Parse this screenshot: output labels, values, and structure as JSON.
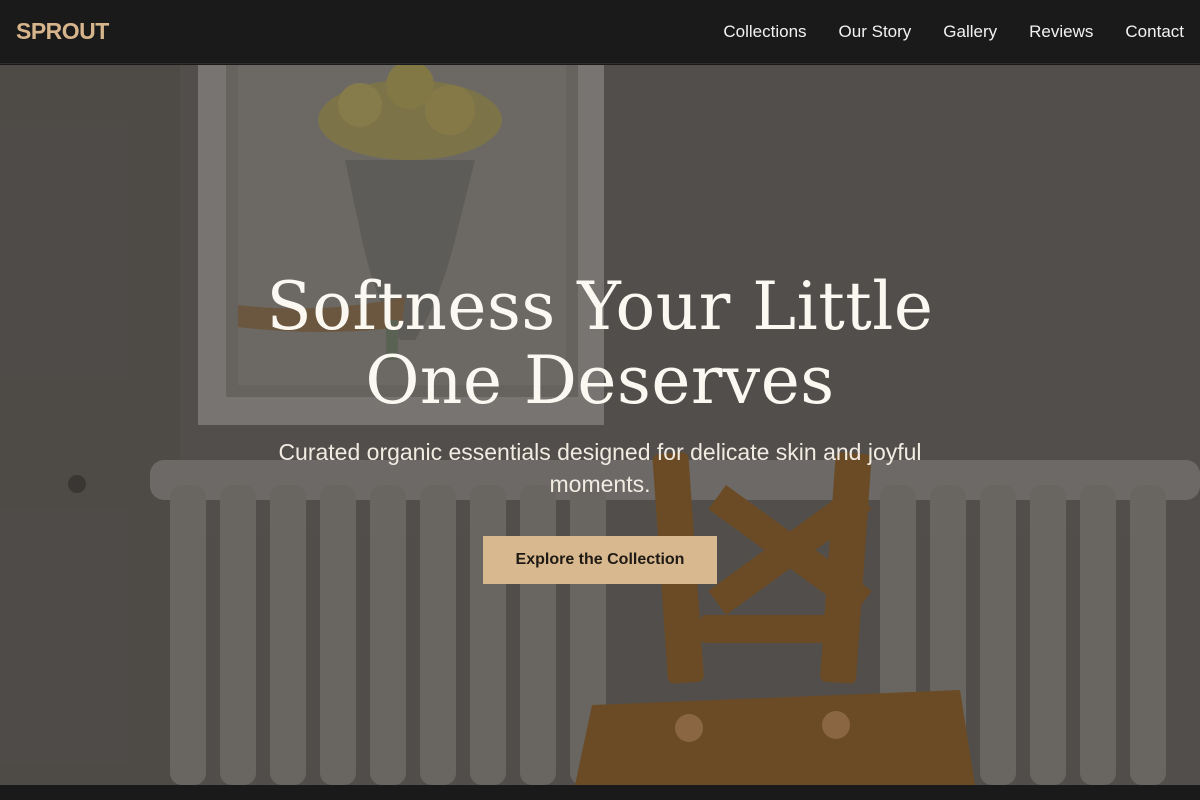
{
  "brand": {
    "name": "SPROUT",
    "color": "#d6b48c"
  },
  "nav": {
    "items": [
      {
        "label": "Collections"
      },
      {
        "label": "Our Story"
      },
      {
        "label": "Gallery"
      },
      {
        "label": "Reviews"
      },
      {
        "label": "Contact"
      }
    ]
  },
  "hero": {
    "title": "Softness Your Little One Deserves",
    "subtitle": "Curated organic essentials designed for delicate skin and joyful moments.",
    "cta_label": "Explore the Collection",
    "cta_color": "#d8b88f"
  }
}
